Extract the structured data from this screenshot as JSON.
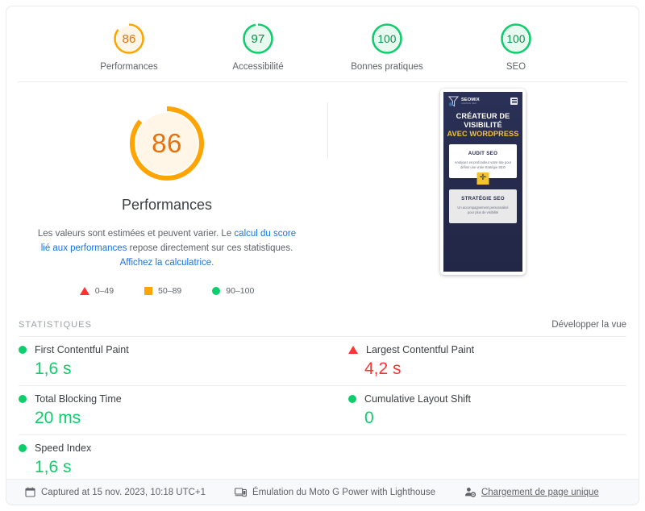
{
  "summary": {
    "items": [
      {
        "score": "86",
        "label": "Performances",
        "color": "#ffa400",
        "track": "#fff6e8",
        "pct": 86
      },
      {
        "score": "97",
        "label": "Accessibilité",
        "color": "#0cce6b",
        "track": "#e8faf0",
        "pct": 97
      },
      {
        "score": "100",
        "label": "Bonnes pratiques",
        "color": "#0cce6b",
        "track": "#e8faf0",
        "pct": 100
      },
      {
        "score": "100",
        "label": "SEO",
        "color": "#0cce6b",
        "track": "#e8faf0",
        "pct": 100
      }
    ]
  },
  "performance": {
    "score": "86",
    "title": "Performances",
    "desc_part1": "Les valeurs sont estimées et peuvent varier. Le ",
    "link1": "calcul du score lié aux performances",
    "desc_part2": " repose directement sur ces statistiques. ",
    "link2": "Affichez la calculatrice",
    "desc_part3": ".",
    "legend": [
      {
        "icon": "triangle-red-icon",
        "range": "0–49"
      },
      {
        "icon": "square-orange-icon",
        "range": "50–89"
      },
      {
        "icon": "circle-green-icon",
        "range": "90–100"
      }
    ]
  },
  "screenshot": {
    "brand": "SEOMIX",
    "brand_sub": "AGENCE SEO",
    "headline_line1": "CRÉATEUR DE",
    "headline_line2": "VISIBILITÉ",
    "headline_line3": "AVEC WORDPRESS",
    "card1_title": "AUDIT SEO",
    "card1_body": "Analysez en profondeur votre site pour définir une vraie stratégie SEO",
    "card1_plus": "✛",
    "card2_title": "STRATÉGIE SEO",
    "card2_body": "Un accompagnement personnalisé pour plus de visibilité"
  },
  "stats": {
    "title": "STATISTIQUES",
    "expand": "Développer la vue",
    "metrics": [
      {
        "name": "First Contentful Paint",
        "value": "1,6 s",
        "status": "good",
        "icon": "circle-green-icon"
      },
      {
        "name": "Largest Contentful Paint",
        "value": "4,2 s",
        "status": "poor",
        "icon": "triangle-red-icon"
      },
      {
        "name": "Total Blocking Time",
        "value": "20 ms",
        "status": "good",
        "icon": "circle-green-icon"
      },
      {
        "name": "Cumulative Layout Shift",
        "value": "0",
        "status": "good",
        "icon": "circle-green-icon"
      },
      {
        "name": "Speed Index",
        "value": "1,6 s",
        "status": "good",
        "icon": "circle-green-icon"
      }
    ]
  },
  "footer": {
    "captured": "Captured at 15 nov. 2023, 10:18 UTC+1",
    "emulation": "Émulation du Moto G Power with Lighthouse",
    "load": "Chargement de page unique"
  },
  "colors": {
    "good": "#0cce6b",
    "average": "#ffa400",
    "poor": "#ff3333",
    "link": "#1a73e8"
  }
}
